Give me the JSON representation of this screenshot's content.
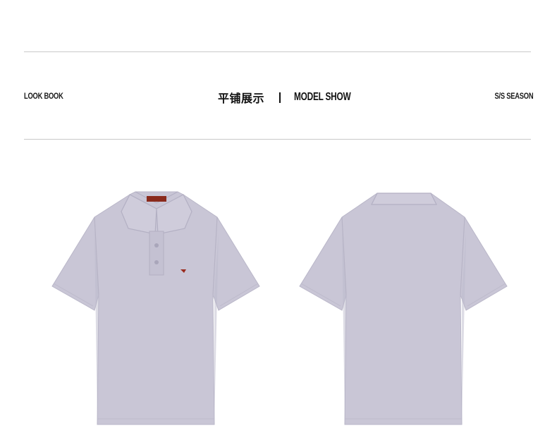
{
  "header": {
    "left_label": "LOOK BOOK",
    "center_cn": "平铺展示",
    "center_en": "MODEL SHOW",
    "right_label": "S/S SEASON"
  },
  "colors": {
    "shirt": "#c9c6d6",
    "shirt_shadow": "#b7b4c6",
    "rule": "#c9c9c9",
    "label": "#9a2b1e"
  },
  "images": [
    {
      "name": "polo-shirt-front",
      "view": "front"
    },
    {
      "name": "polo-shirt-back",
      "view": "back"
    }
  ]
}
